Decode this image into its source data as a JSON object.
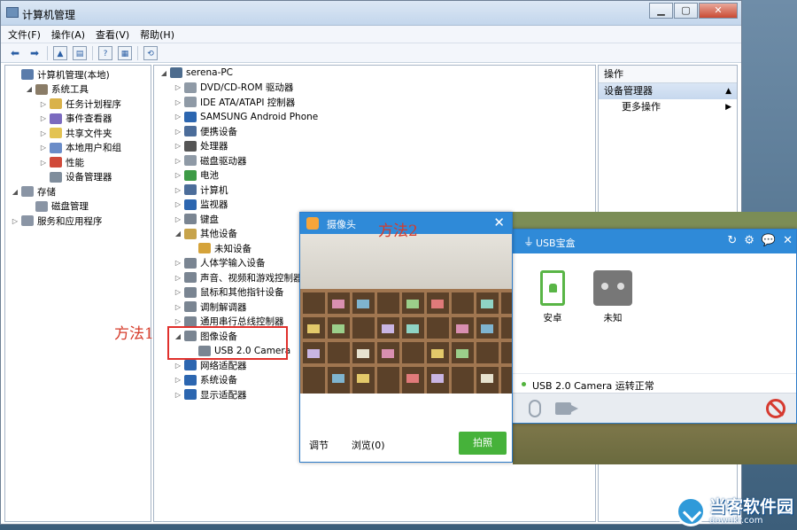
{
  "window": {
    "title": "计算机管理",
    "min": "▁",
    "max": "▢",
    "close": "✕"
  },
  "menu": [
    "文件(F)",
    "操作(A)",
    "查看(V)",
    "帮助(H)"
  ],
  "left_tree": [
    {
      "label": "计算机管理(本地)",
      "level": 0,
      "exp": "",
      "icon": "computer-management-icon",
      "color": "#5a7cab"
    },
    {
      "label": "系统工具",
      "level": 1,
      "exp": "◢",
      "icon": "system-tools-icon",
      "color": "#8a7c67"
    },
    {
      "label": "任务计划程序",
      "level": 2,
      "exp": "▷",
      "icon": "clock-icon",
      "color": "#d9b24a"
    },
    {
      "label": "事件查看器",
      "level": 2,
      "exp": "▷",
      "icon": "event-viewer-icon",
      "color": "#7b6abf"
    },
    {
      "label": "共享文件夹",
      "level": 2,
      "exp": "▷",
      "icon": "shared-folder-icon",
      "color": "#e3c353"
    },
    {
      "label": "本地用户和组",
      "level": 2,
      "exp": "▷",
      "icon": "users-icon",
      "color": "#6a8cc8"
    },
    {
      "label": "性能",
      "level": 2,
      "exp": "▷",
      "icon": "performance-icon",
      "color": "#d04a3a"
    },
    {
      "label": "设备管理器",
      "level": 2,
      "exp": "",
      "icon": "device-manager-icon",
      "color": "#7f8d9c"
    },
    {
      "label": "存储",
      "level": 0,
      "exp": "◢",
      "icon": "storage-icon",
      "color": "#8a95a5"
    },
    {
      "label": "磁盘管理",
      "level": 1,
      "exp": "",
      "icon": "disk-icon",
      "color": "#8a95a5"
    },
    {
      "label": "服务和应用程序",
      "level": 0,
      "exp": "▷",
      "icon": "services-icon",
      "color": "#8a95a5"
    }
  ],
  "device_tree": [
    {
      "label": "serena-PC",
      "level": 0,
      "exp": "◢",
      "icon": "computer-icon",
      "color": "#4d6c8e"
    },
    {
      "label": "DVD/CD-ROM 驱动器",
      "level": 1,
      "exp": "▷",
      "icon": "dvd-icon",
      "color": "#8f9aa6"
    },
    {
      "label": "IDE ATA/ATAPI 控制器",
      "level": 1,
      "exp": "▷",
      "icon": "ide-icon",
      "color": "#8f9aa6"
    },
    {
      "label": "SAMSUNG Android Phone",
      "level": 1,
      "exp": "▷",
      "icon": "phone-icon",
      "color": "#2c66b0"
    },
    {
      "label": "便携设备",
      "level": 1,
      "exp": "▷",
      "icon": "portable-icon",
      "color": "#4c6d9a"
    },
    {
      "label": "处理器",
      "level": 1,
      "exp": "▷",
      "icon": "processor-icon",
      "color": "#555"
    },
    {
      "label": "磁盘驱动器",
      "level": 1,
      "exp": "▷",
      "icon": "disk-drive-icon",
      "color": "#8f9aa6"
    },
    {
      "label": "电池",
      "level": 1,
      "exp": "▷",
      "icon": "battery-icon",
      "color": "#3d9b46"
    },
    {
      "label": "计算机",
      "level": 1,
      "exp": "▷",
      "icon": "pc-icon",
      "color": "#4c6d9a"
    },
    {
      "label": "监视器",
      "level": 1,
      "exp": "▷",
      "icon": "monitor-icon",
      "color": "#2c66b0"
    },
    {
      "label": "键盘",
      "level": 1,
      "exp": "▷",
      "icon": "keyboard-icon",
      "color": "#7a8592"
    },
    {
      "label": "其他设备",
      "level": 1,
      "exp": "◢",
      "icon": "other-devices-icon",
      "color": "#c7a34b"
    },
    {
      "label": "未知设备",
      "level": 2,
      "exp": "",
      "icon": "unknown-device-icon",
      "color": "#d5a33a"
    },
    {
      "label": "人体学输入设备",
      "level": 1,
      "exp": "▷",
      "icon": "hid-icon",
      "color": "#7a8592"
    },
    {
      "label": "声音、视频和游戏控制器",
      "level": 1,
      "exp": "▷",
      "icon": "sound-icon",
      "color": "#7a8592"
    },
    {
      "label": "鼠标和其他指针设备",
      "level": 1,
      "exp": "▷",
      "icon": "mouse-icon",
      "color": "#7a8592"
    },
    {
      "label": "调制解调器",
      "level": 1,
      "exp": "▷",
      "icon": "modem-icon",
      "color": "#7a8592"
    },
    {
      "label": "通用串行总线控制器",
      "level": 1,
      "exp": "▷",
      "icon": "usb-controller-icon",
      "color": "#7a8592"
    },
    {
      "label": "图像设备",
      "level": 1,
      "exp": "◢",
      "icon": "imaging-icon",
      "color": "#7a8592"
    },
    {
      "label": "USB 2.0 Camera",
      "level": 2,
      "exp": "",
      "icon": "camera-icon",
      "color": "#7a8592"
    },
    {
      "label": "网络适配器",
      "level": 1,
      "exp": "▷",
      "icon": "network-icon",
      "color": "#2c66b0"
    },
    {
      "label": "系统设备",
      "level": 1,
      "exp": "▷",
      "icon": "system-device-icon",
      "color": "#2c66b0"
    },
    {
      "label": "显示适配器",
      "level": 1,
      "exp": "▷",
      "icon": "display-adapter-icon",
      "color": "#2c66b0"
    }
  ],
  "actions": {
    "header": "操作",
    "section": "设备管理器",
    "more": "更多操作"
  },
  "annotations": {
    "method1": "方法1",
    "method2": "方法2"
  },
  "camera": {
    "title": "摄像头",
    "close": "✕",
    "adjust": "调节",
    "browse": "浏览(0)",
    "shoot": "拍照"
  },
  "usb": {
    "title": "USB宝盒",
    "devices": [
      {
        "label": "安卓"
      },
      {
        "label": "未知"
      }
    ],
    "status": "USB 2.0 Camera 运转正常"
  },
  "watermark": {
    "name": "当客软件园",
    "url": "downkr.com"
  }
}
